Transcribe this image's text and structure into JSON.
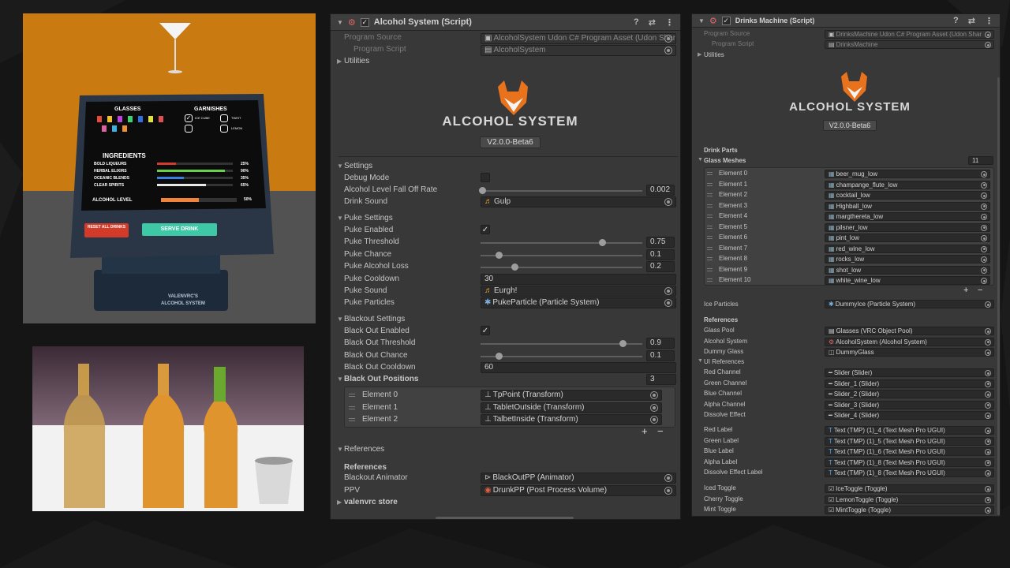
{
  "colors": {
    "panel": "#383838",
    "field": "#2a2a2a",
    "accent": "#e07a1c",
    "background": "#151515"
  },
  "tablet": {
    "glasses_title": "GLASSES",
    "garnishes_title": "GARNISHES",
    "garnish_labels": [
      "ICE CUBE",
      "TWIST",
      "",
      "LEMON"
    ],
    "ingredients_title": "INGREDIENTS",
    "ingredients": [
      {
        "name": "BOLD LIQUEURS",
        "pct": "25%",
        "level": 0.25,
        "color": "#d33b2c"
      },
      {
        "name": "HERBAL ELIXIRS",
        "pct": "90%",
        "level": 0.9,
        "color": "#6bd04a"
      },
      {
        "name": "OCEANIC BLENDS",
        "pct": "35%",
        "level": 0.35,
        "color": "#3c7de0"
      },
      {
        "name": "CLEAR SPIRITS",
        "pct": "65%",
        "level": 0.65,
        "color": "#e8e8e8"
      }
    ],
    "alcohol_label": "ALCOHOL LEVEL",
    "alcohol_pct": "50%",
    "alcohol_level": 0.5,
    "reset_label": "RESET ALL DRINKS",
    "serve_label": "SERVE DRINK",
    "brand_line1": "VALENVRC'S",
    "brand_line2": "ALCOHOL SYSTEM"
  },
  "left_panel": {
    "title": "Alcohol System (Script)",
    "program_source_label": "Program Source",
    "program_source_value": "AlcoholSystem Udon C# Program Asset (Udon Shar",
    "program_script_label": "Program Script",
    "program_script_value": "AlcoholSystem",
    "utilities_label": "Utilities",
    "logo_text": "ALCOHOL SYSTEM",
    "version": "V2.0.0-Beta6",
    "settings_header": "Settings",
    "debug_mode_label": "Debug Mode",
    "falloff_label": "Alcohol Level Fall Off Rate",
    "falloff_value": "0.002",
    "drink_sound_label": "Drink Sound",
    "drink_sound_value": "Gulp",
    "puke_header": "Puke Settings",
    "puke_enabled_label": "Puke Enabled",
    "puke_threshold_label": "Puke Threshold",
    "puke_threshold_value": "0.75",
    "puke_chance_label": "Puke Chance",
    "puke_chance_value": "0.1",
    "puke_loss_label": "Puke Alcohol Loss",
    "puke_loss_value": "0.2",
    "puke_cooldown_label": "Puke Cooldown",
    "puke_cooldown_value": "30",
    "puke_sound_label": "Puke Sound",
    "puke_sound_value": "Eurgh!",
    "puke_particles_label": "Puke Particles",
    "puke_particles_value": "PukeParticle (Particle System)",
    "blackout_header": "Blackout Settings",
    "blackout_enabled_label": "Black Out Enabled",
    "blackout_threshold_label": "Black Out Threshold",
    "blackout_threshold_value": "0.9",
    "blackout_chance_label": "Black Out Chance",
    "blackout_chance_value": "0.1",
    "blackout_cooldown_label": "Black Out Cooldown",
    "blackout_cooldown_value": "60",
    "positions_label": "Black Out Positions",
    "positions_count": "3",
    "positions": [
      {
        "label": "Element 0",
        "value": "TpPoint (Transform)"
      },
      {
        "label": "Element 1",
        "value": "TabletOutside (Transform)"
      },
      {
        "label": "Element 2",
        "value": "TalbetInside (Transform)"
      }
    ],
    "plus": "+",
    "minus": "−",
    "references_fold": "References",
    "references_title": "References",
    "blackout_animator_label": "Blackout Animator",
    "blackout_animator_value": "BlackOutPP (Animator)",
    "ppv_label": "PPV",
    "ppv_value": "DrunkPP (Post Process Volume)",
    "store_label": "valenvrc store"
  },
  "right_panel": {
    "title": "Drinks Machine (Script)",
    "program_source_label": "Program Source",
    "program_source_value": "DrinksMachine Udon C# Program Asset (Udon Shar",
    "program_script_label": "Program Script",
    "program_script_value": "DrinksMachine",
    "utilities_label": "Utilities",
    "logo_text": "ALCOHOL SYSTEM",
    "version": "V2.0.0-Beta6",
    "drink_parts_label": "Drink Parts",
    "glass_meshes_label": "Glass Meshes",
    "glass_meshes_count": "11",
    "meshes": [
      {
        "label": "Element 0",
        "value": "beer_mug_low"
      },
      {
        "label": "Element 1",
        "value": "champange_flute_low"
      },
      {
        "label": "Element 2",
        "value": "cocktail_low"
      },
      {
        "label": "Element 3",
        "value": "Highball_low"
      },
      {
        "label": "Element 4",
        "value": "margthereta_low"
      },
      {
        "label": "Element 5",
        "value": "pilsner_low"
      },
      {
        "label": "Element 6",
        "value": "pint_low"
      },
      {
        "label": "Element 7",
        "value": "red_wine_low"
      },
      {
        "label": "Element 8",
        "value": "rocks_low"
      },
      {
        "label": "Element 9",
        "value": "shot_low"
      },
      {
        "label": "Element 10",
        "value": "white_wine_low"
      }
    ],
    "plus": "+",
    "minus": "−",
    "ice_particles_label": "Ice Particles",
    "ice_particles_value": "DummyIce (Particle System)",
    "references_label": "References",
    "refs": [
      {
        "label": "Glass Pool",
        "value": "Glasses (VRC Object Pool)"
      },
      {
        "label": "Alcohol System",
        "value": "AlcoholSystem (Alcohol System)"
      },
      {
        "label": "Dummy Glass",
        "value": "DummyGlass"
      }
    ],
    "ui_refs_label": "UI References",
    "sliders": [
      {
        "label": "Red Channel",
        "value": "Slider (Slider)"
      },
      {
        "label": "Green Channel",
        "value": "Slider_1 (Slider)"
      },
      {
        "label": "Blue Channel",
        "value": "Slider_2 (Slider)"
      },
      {
        "label": "Alpha Channel",
        "value": "Slider_3 (Slider)"
      },
      {
        "label": "Dissolve Effect",
        "value": "Slider_4 (Slider)"
      }
    ],
    "labels": [
      {
        "label": "Red Label",
        "value": "Text (TMP) (1)_4 (Text Mesh Pro UGUI)"
      },
      {
        "label": "Green Label",
        "value": "Text (TMP) (1)_5 (Text Mesh Pro UGUI)"
      },
      {
        "label": "Blue Label",
        "value": "Text (TMP) (1)_6 (Text Mesh Pro UGUI)"
      },
      {
        "label": "Alpha Label",
        "value": "Text (TMP) (1)_8 (Text Mesh Pro UGUI)"
      },
      {
        "label": "Dissolve Effect Label",
        "value": "Text (TMP) (1)_8 (Text Mesh Pro UGUI)"
      }
    ],
    "toggles": [
      {
        "label": "Iced Toggle",
        "value": "IceToggle (Toggle)"
      },
      {
        "label": "Cherry Toggle",
        "value": "LemonToggle (Toggle)"
      },
      {
        "label": "Mint Toggle",
        "value": "MintToggle (Toggle)"
      }
    ]
  }
}
